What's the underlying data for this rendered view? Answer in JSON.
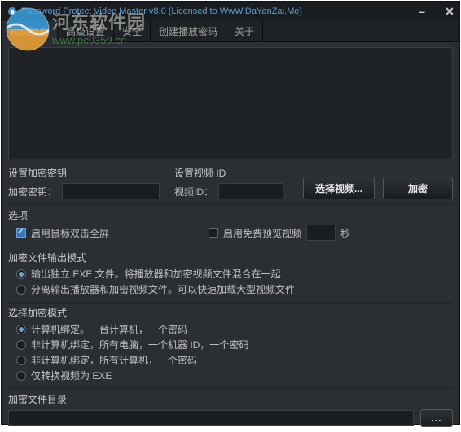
{
  "title": "Password Protect Video Master v8.0 (Licensed to WwW.DaYanZai.Me)",
  "watermark": {
    "line1": "河东软件园",
    "line2": "www.pc0359.cn"
  },
  "tabs": [
    {
      "label": "视频加密"
    },
    {
      "label": "高级设置"
    },
    {
      "label": "安全"
    },
    {
      "label": "创建播放密码"
    },
    {
      "label": "关于"
    }
  ],
  "key": {
    "section": "设置加密密钥",
    "label": "加密密钥：",
    "value": ""
  },
  "vid": {
    "section": "设置视频 ID",
    "label": "视频ID：",
    "value": ""
  },
  "buttons": {
    "select_video": "选择视频...",
    "encrypt": "加密",
    "browse": "..."
  },
  "options": {
    "title": "选项",
    "dblclick_fullscreen": "启用鼠标双击全屏",
    "free_preview": "启用免费预览视频",
    "seconds_suffix": "秒",
    "preview_value": ""
  },
  "output_mode": {
    "title": "加密文件输出模式",
    "opt_single_exe": "输出独立 EXE 文件。将播放器和加密视频文件混合在一起",
    "opt_separate": "分离输出播放器和加密视频文件。可以快速加载大型视频文件"
  },
  "encrypt_mode": {
    "title": "选择加密模式",
    "opt_pc_bind": "计算机绑定。一台计算机，一个密码",
    "opt_not_bind_machine_id": "非计算机绑定，所有电脑，一个机器 ID，一个密码",
    "opt_not_bind_all": "非计算机绑定，所有计算机，一个密码",
    "opt_exe_only": "仅转换视频为 EXE"
  },
  "dir": {
    "title": "加密文件目录",
    "value": ""
  }
}
